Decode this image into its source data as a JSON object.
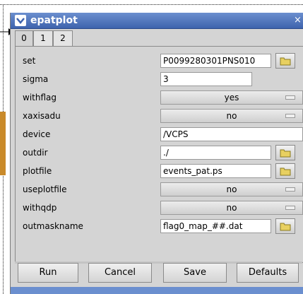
{
  "window": {
    "title": "epatplot",
    "close_glyph": "×",
    "menu_icon": "chevron-down-icon"
  },
  "tabs": [
    {
      "label": "0",
      "active": true
    },
    {
      "label": "1",
      "active": false
    },
    {
      "label": "2",
      "active": false
    }
  ],
  "params": {
    "set": {
      "label": "set",
      "value": "P0099280301PNS010"
    },
    "sigma": {
      "label": "sigma",
      "value": "3"
    },
    "withflag": {
      "label": "withflag",
      "value": "yes"
    },
    "xaxisadu": {
      "label": "xaxisadu",
      "value": "no"
    },
    "device": {
      "label": "device",
      "value": "/VCPS"
    },
    "outdir": {
      "label": "outdir",
      "value": "./"
    },
    "plotfile": {
      "label": "plotfile",
      "value": "events_pat.ps"
    },
    "useplotfile": {
      "label": "useplotfile",
      "value": "no"
    },
    "withqdp": {
      "label": "withqdp",
      "value": "no"
    },
    "outmaskname": {
      "label": "outmaskname",
      "value": "flag0_map_##.dat"
    }
  },
  "buttons": {
    "run": "Run",
    "cancel": "Cancel",
    "save": "Save",
    "defaults": "Defaults"
  },
  "colors": {
    "titlebar": "#3e63ad",
    "folder": "#e8d060"
  }
}
